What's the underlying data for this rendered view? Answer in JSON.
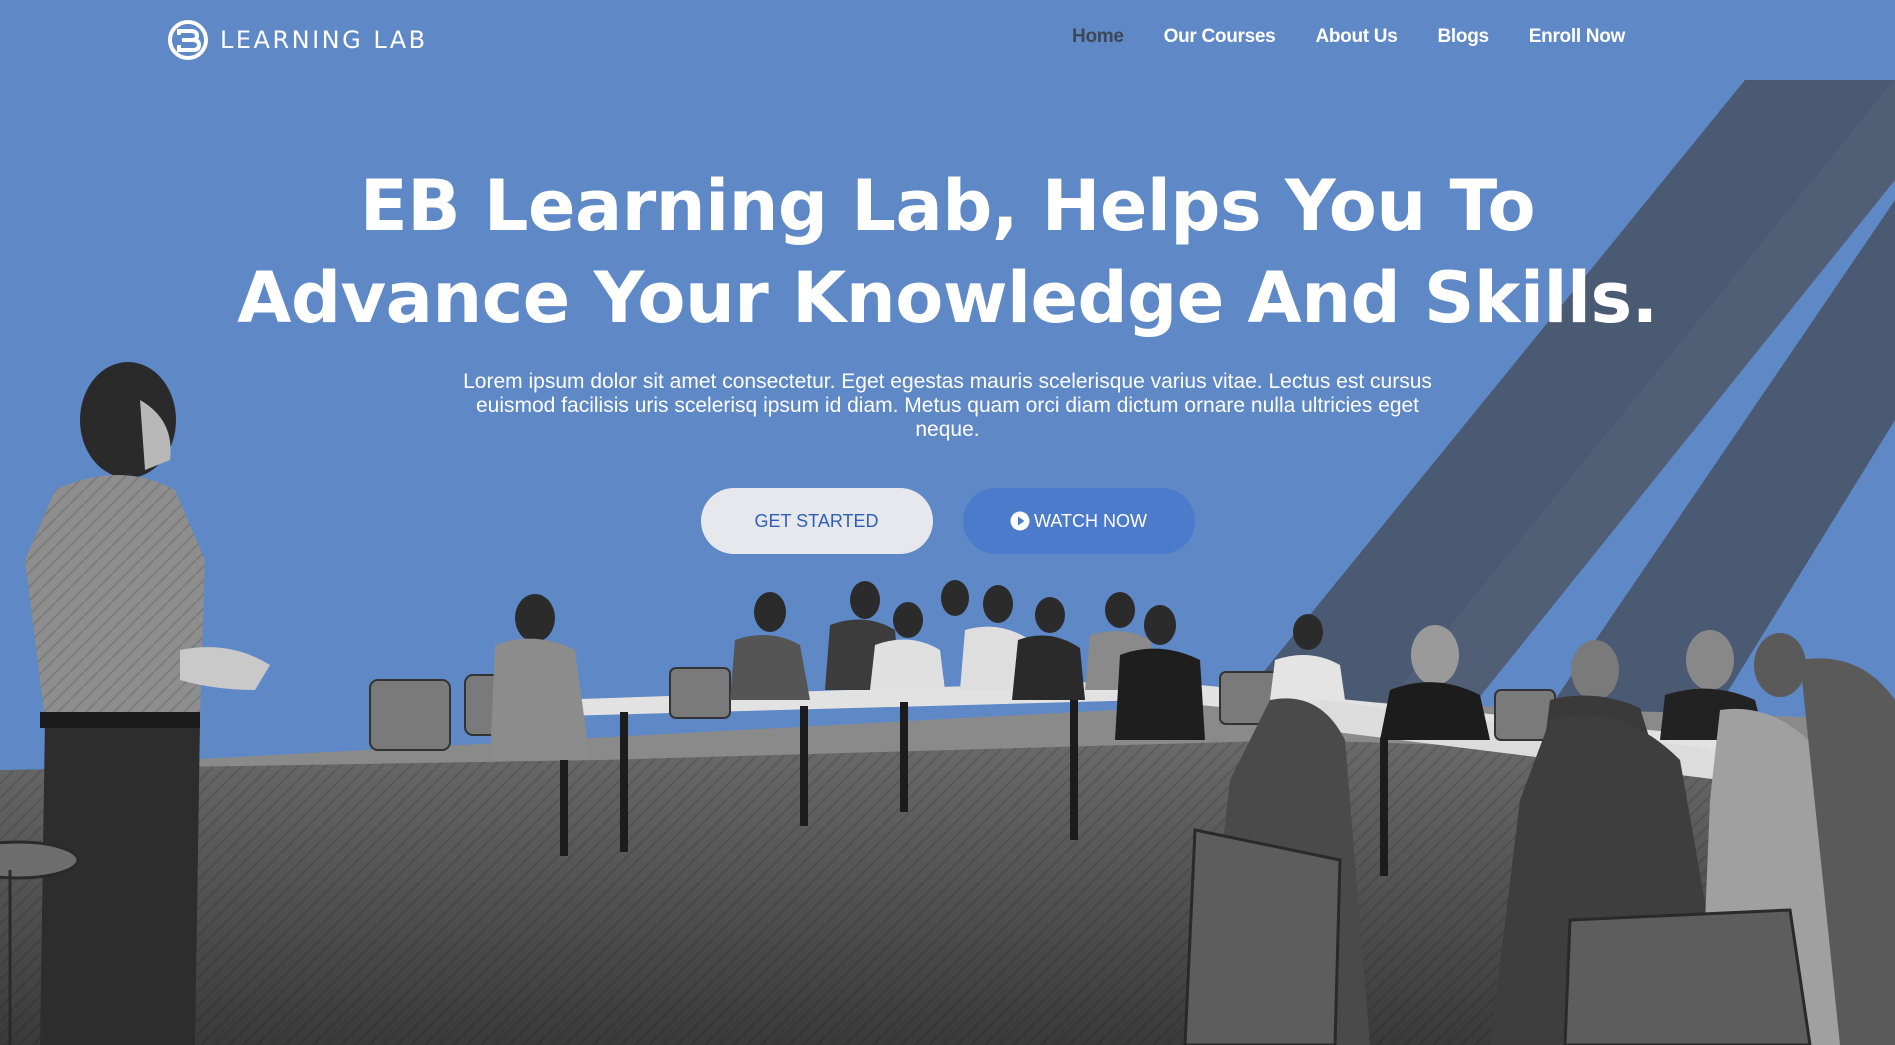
{
  "brand": {
    "logo_text": "LEARNING LAB",
    "icon": "eb-logo-icon"
  },
  "nav": {
    "items": [
      {
        "label": "Home",
        "active": true
      },
      {
        "label": "Our Courses",
        "active": false
      },
      {
        "label": "About Us",
        "active": false
      },
      {
        "label": "Blogs",
        "active": false
      },
      {
        "label": "Enroll Now",
        "active": false
      }
    ]
  },
  "hero": {
    "title_line1": "EB Learning Lab, Helps You To",
    "title_line2": "Advance Your Knowledge And Skills.",
    "description": "Lorem ipsum dolor sit amet consectetur. Eget egestas mauris scelerisque varius vitae. Lectus est cursus euismod facilisis uris scelerisq ipsum id diam. Metus quam orci diam dictum ornare nulla ultricies eget neque.",
    "primary_cta": "GET STARTED",
    "secondary_cta": "WATCH NOW",
    "secondary_cta_icon": "play-circle-icon"
  },
  "colors": {
    "background": "#5e88c6",
    "stripe": "#4b5a73",
    "active_nav": "#3d4756",
    "primary_button_bg": "#e6e8ee",
    "primary_button_text": "#2f5fb3",
    "secondary_button_bg": "#4c7bcb"
  }
}
